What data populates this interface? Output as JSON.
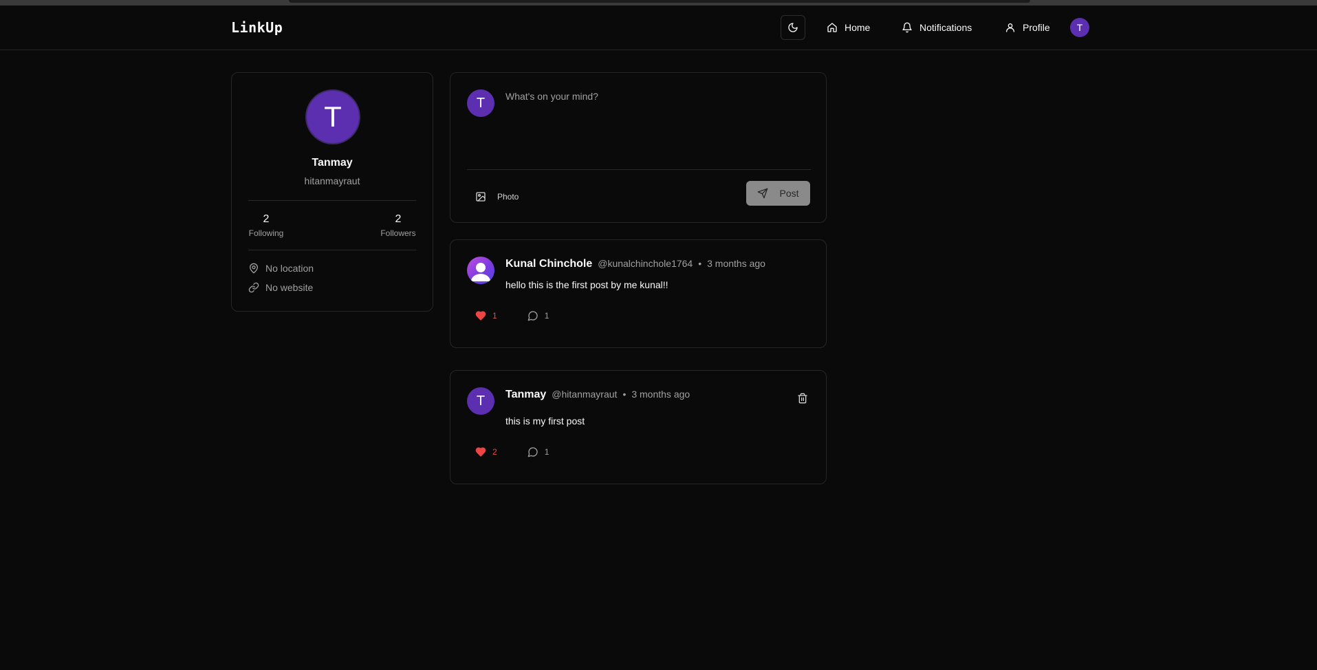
{
  "app": {
    "logo": "LinkUp"
  },
  "nav": {
    "items": [
      {
        "label": "Home",
        "icon": "home-icon"
      },
      {
        "label": "Notifications",
        "icon": "bell-icon"
      },
      {
        "label": "Profile",
        "icon": "user-icon"
      }
    ],
    "theme_toggle_icon": "moon-icon",
    "avatar_initial": "T"
  },
  "profile": {
    "initial": "T",
    "name": "Tanmay",
    "username": "hitanmayraut",
    "following_count": "2",
    "following_label": "Following",
    "followers_count": "2",
    "followers_label": "Followers",
    "location": "No location",
    "website": "No website"
  },
  "composer": {
    "avatar_initial": "T",
    "placeholder": "What's on your mind?",
    "photo_label": "Photo",
    "post_label": "Post"
  },
  "posts": [
    {
      "author": "Kunal Chinchole",
      "handle": "@kunalchinchole1764",
      "separator": "•",
      "time": "3 months ago",
      "content": "hello this is the first post by me kunal!!",
      "likes": "1",
      "comments": "1"
    },
    {
      "author": "Tanmay",
      "avatar_initial": "T",
      "handle": "@hitanmayraut",
      "separator": "•",
      "time": "3 months ago",
      "content": "this is my first post",
      "likes": "2",
      "comments": "1"
    }
  ],
  "colors": {
    "background": "#0a0a0a",
    "border": "#262626",
    "accent_avatar": "#5b2fb0",
    "like": "#ef4444",
    "muted_text": "#a1a1a1"
  }
}
